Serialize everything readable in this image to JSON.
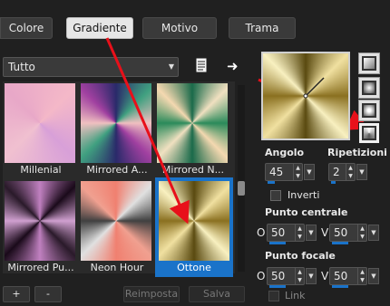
{
  "tabs": [
    {
      "label": "Colore"
    },
    {
      "label": "Gradiente",
      "active": true
    },
    {
      "label": "Motivo"
    },
    {
      "label": "Trama"
    }
  ],
  "category_select": {
    "value": "Tutto"
  },
  "gradients": [
    {
      "label": "Millenial"
    },
    {
      "label": "Mirrored A..."
    },
    {
      "label": "Mirrored N..."
    },
    {
      "label": "Mirrored Pu..."
    },
    {
      "label": "Neon Hour"
    },
    {
      "label": "Ottone",
      "selected": true
    }
  ],
  "bottom_buttons": {
    "add": "+",
    "remove": "-",
    "reset": "Reimposta",
    "save": "Salva"
  },
  "settings": {
    "angle_label": "Angolo",
    "angle_value": "45",
    "repeats_label": "Ripetizioni",
    "repeats_value": "2",
    "invert_label": "Inverti",
    "center_label": "Punto centrale",
    "center_o_axis": "O",
    "center_o_value": "50",
    "center_v_axis": "V",
    "center_v_value": "50",
    "focal_label": "Punto focale",
    "focal_o_axis": "O",
    "focal_o_value": "50",
    "focal_v_axis": "V",
    "focal_v_value": "50",
    "link_label": "Link"
  },
  "icons": {
    "page": "page-icon",
    "arrow": "arrow-right-icon"
  }
}
